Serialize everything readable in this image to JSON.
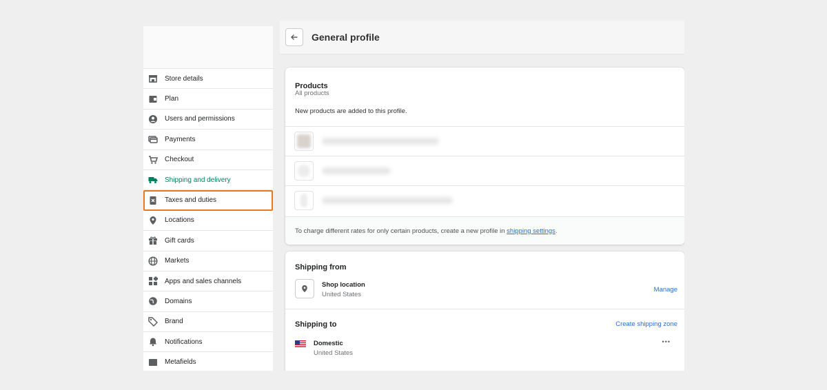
{
  "sidebar": {
    "items": [
      {
        "label": "Store details",
        "icon": "store-icon"
      },
      {
        "label": "Plan",
        "icon": "plan-icon"
      },
      {
        "label": "Users and permissions",
        "icon": "user-icon"
      },
      {
        "label": "Payments",
        "icon": "payments-icon"
      },
      {
        "label": "Checkout",
        "icon": "cart-icon"
      },
      {
        "label": "Shipping and delivery",
        "icon": "truck-icon"
      },
      {
        "label": "Taxes and duties",
        "icon": "tax-icon"
      },
      {
        "label": "Locations",
        "icon": "location-icon"
      },
      {
        "label": "Gift cards",
        "icon": "gift-icon"
      },
      {
        "label": "Markets",
        "icon": "globe-icon"
      },
      {
        "label": "Apps and sales channels",
        "icon": "apps-icon"
      },
      {
        "label": "Domains",
        "icon": "domain-icon"
      },
      {
        "label": "Brand",
        "icon": "brand-icon"
      },
      {
        "label": "Notifications",
        "icon": "bell-icon"
      },
      {
        "label": "Metafields",
        "icon": "metafields-icon"
      }
    ],
    "active_item": "Shipping and delivery",
    "highlighted_item": "Taxes and duties"
  },
  "header": {
    "title": "General profile"
  },
  "products": {
    "title": "Products",
    "subtitle": "All products",
    "note": "New products are added to this profile.",
    "footer_text": "To charge different rates for only certain products, create a new profile in ",
    "footer_link": "shipping settings",
    "footer_end": "."
  },
  "shipping_from": {
    "title": "Shipping from",
    "location_name": "Shop location",
    "location_country": "United States",
    "manage_label": "Manage"
  },
  "shipping_to": {
    "title": "Shipping to",
    "create_zone_label": "Create shipping zone",
    "zone_name": "Domestic",
    "zone_country": "United States",
    "more_label": "•••"
  },
  "colors": {
    "accent": "#008060",
    "highlight": "#e8781f",
    "link": "#2c6ecb"
  }
}
